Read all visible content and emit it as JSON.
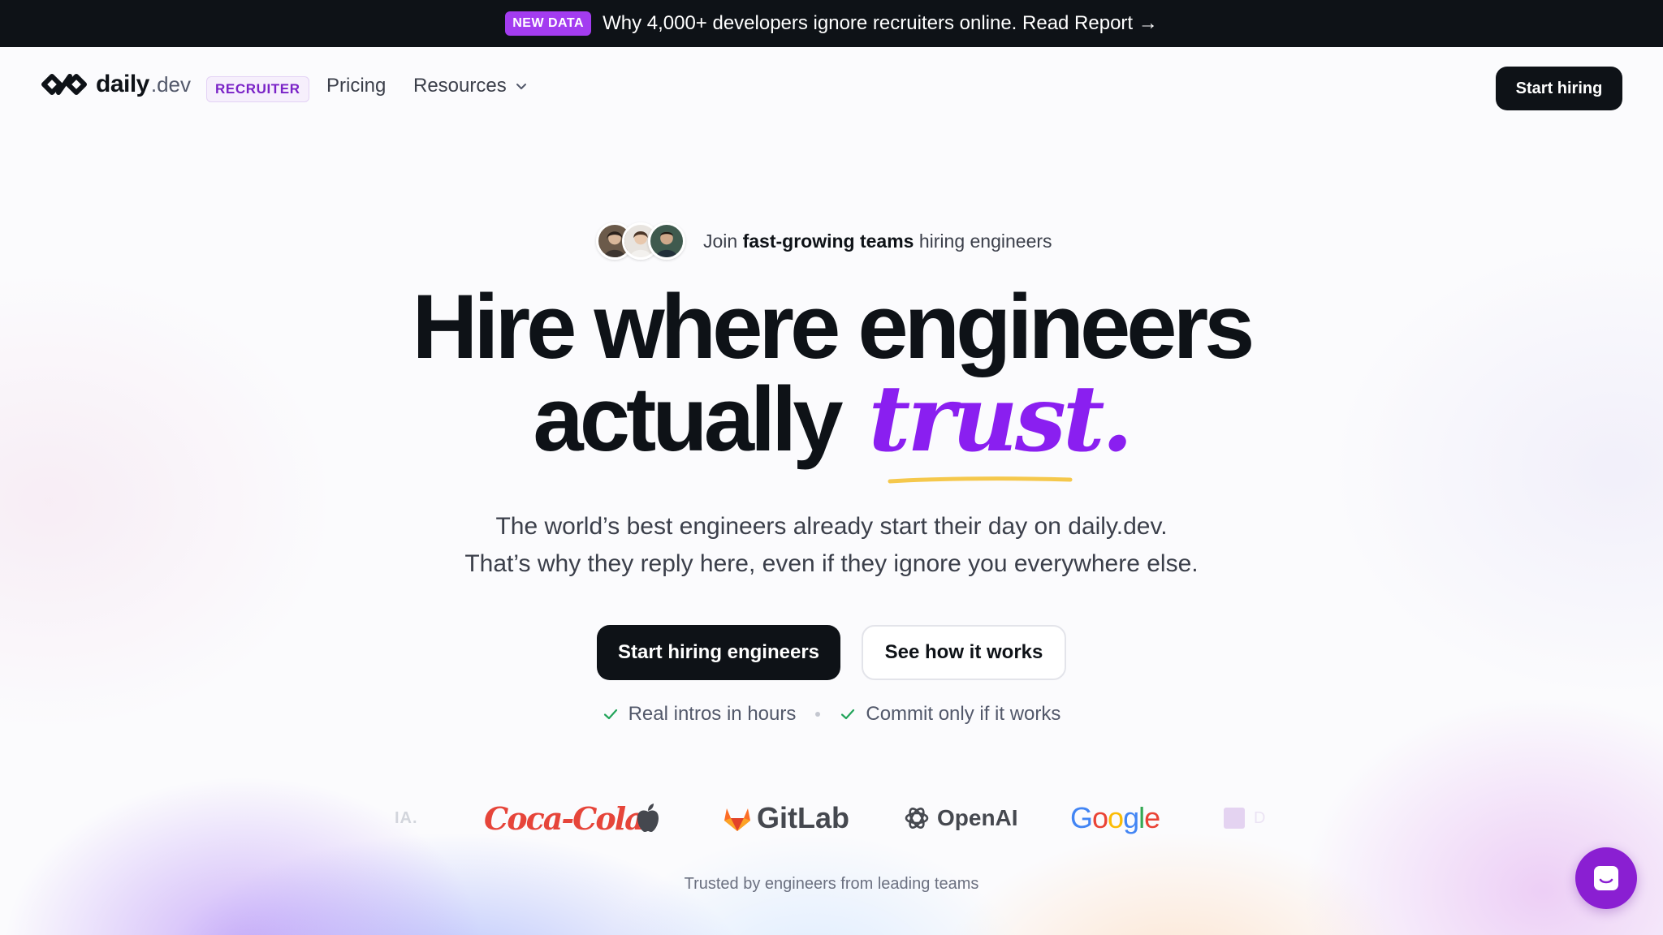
{
  "announcement": {
    "badge": "NEW DATA",
    "text": "Why 4,000+ developers ignore recruiters online. Read Report →"
  },
  "header": {
    "logo_word": "daily",
    "logo_suffix": ".dev",
    "badge": "RECRUITER",
    "nav": [
      {
        "label": "Pricing"
      },
      {
        "label": "Resources",
        "icon": "chevron-down-icon"
      }
    ],
    "cta": "Start hiring"
  },
  "hero": {
    "proof_prefix": "Join",
    "proof_bold": "fast-growing teams",
    "proof_suffix": "hiring engineers",
    "headline_line1": "Hire where engineers",
    "headline_line2": "actually",
    "headline_accent": "trust.",
    "accent_color": "#8a1ff0",
    "underline_color": "#f5c84c",
    "subtext_line1": "The world’s best engineers already start their day on daily.dev.",
    "subtext_line2": "That’s why they reply here, even if they ignore you everywhere else.",
    "primary_cta": "Start hiring engineers",
    "secondary_cta": "See how it works",
    "checks": [
      "Real intros in hours",
      "Commit only if it works"
    ]
  },
  "logos": {
    "items": [
      {
        "name": "partial-logo",
        "text": "IA."
      },
      {
        "name": "coca-cola",
        "text": "Coca-Cola"
      },
      {
        "name": "apple",
        "icon": "apple-icon"
      },
      {
        "name": "gitlab",
        "text": "GitLab",
        "icon": "gitlab-icon"
      },
      {
        "name": "openai",
        "text": "OpenAI",
        "icon": "openai-icon"
      },
      {
        "name": "google",
        "letters": [
          "G",
          "o",
          "o",
          "g",
          "l",
          "e"
        ]
      },
      {
        "name": "faded-logo",
        "text": "D"
      }
    ],
    "trusted_text": "Trusted by engineers from leading teams"
  },
  "chat": {
    "icon": "chat-icon",
    "color": "#8a1fd2"
  }
}
